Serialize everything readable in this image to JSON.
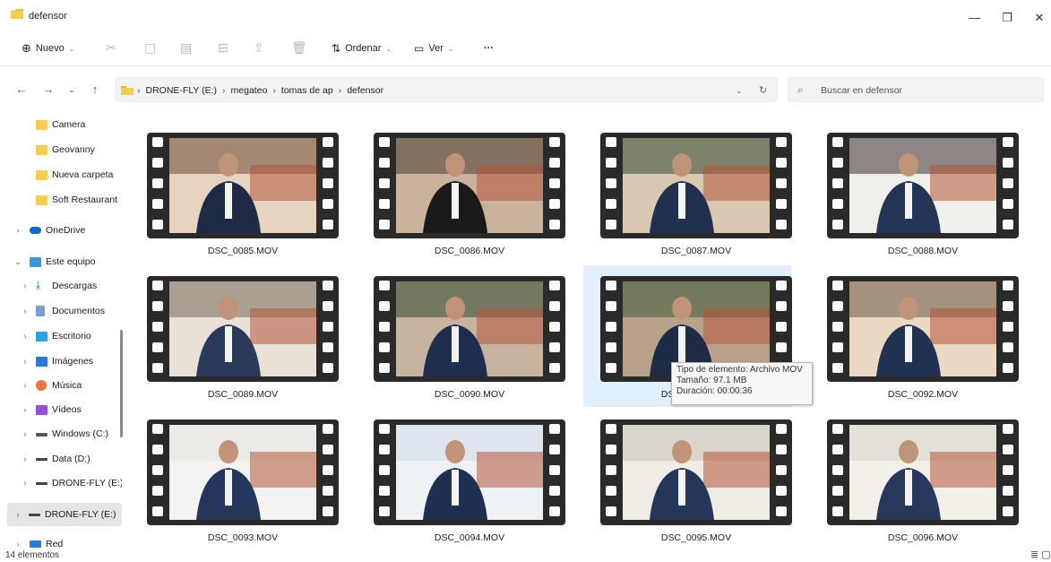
{
  "window": {
    "title": "defensor",
    "minimize": "—",
    "restore": "❐",
    "close": "✕"
  },
  "toolbar": {
    "new_label": "Nuevo",
    "sort_label": "Ordenar",
    "view_label": "Ver",
    "more_label": "···"
  },
  "address": {
    "crumbs": [
      "DRONE-FLY (E:)",
      "megateo",
      "tomas de ap",
      "defensor"
    ],
    "separator": "›"
  },
  "search": {
    "placeholder": "Buscar en defensor"
  },
  "sidebar": {
    "items": [
      {
        "label": "Camera",
        "icon": "folder-icon"
      },
      {
        "label": "Geovanny",
        "icon": "folder-icon"
      },
      {
        "label": "Nueva carpeta",
        "icon": "folder-icon"
      },
      {
        "label": "Soft Restaurant",
        "icon": "folder-icon"
      },
      {
        "label": "OneDrive",
        "icon": "cloud-icon"
      },
      {
        "label": "Este equipo",
        "icon": "computer-icon"
      },
      {
        "label": "Descargas",
        "icon": "download-icon"
      },
      {
        "label": "Documentos",
        "icon": "documents-icon"
      },
      {
        "label": "Escritorio",
        "icon": "desktop-icon"
      },
      {
        "label": "Imágenes",
        "icon": "pictures-icon"
      },
      {
        "label": "Música",
        "icon": "music-icon"
      },
      {
        "label": "Vídeos",
        "icon": "videos-icon"
      },
      {
        "label": "Windows (C:)",
        "icon": "drive-icon"
      },
      {
        "label": "Data (D:)",
        "icon": "drive-icon"
      },
      {
        "label": "DRONE-FLY (E:)",
        "icon": "drive-icon"
      },
      {
        "label": "DRONE-FLY (E:)",
        "icon": "drive-icon"
      },
      {
        "label": "Red",
        "icon": "network-icon"
      }
    ]
  },
  "files": [
    {
      "name": "DSC_0085.MOV"
    },
    {
      "name": "DSC_0086.MOV"
    },
    {
      "name": "DSC_0087.MOV"
    },
    {
      "name": "DSC_0088.MOV"
    },
    {
      "name": "DSC_0089.MOV"
    },
    {
      "name": "DSC_0090.MOV"
    },
    {
      "name": "DSC_0091.MOV"
    },
    {
      "name": "DSC_0092.MOV"
    },
    {
      "name": "DSC_0093.MOV"
    },
    {
      "name": "DSC_0094.MOV"
    },
    {
      "name": "DSC_0095.MOV"
    },
    {
      "name": "DSC_0096.MOV"
    }
  ],
  "tooltip": {
    "type_line": "Tipo de elemento: Archivo MOV",
    "size_line": "Tamaño: 97.1 MB",
    "duration_line": "Duración: 00:00:36"
  },
  "status": {
    "count": "14 elementos"
  },
  "colors": {
    "folder": "#f0c040",
    "accent": "#0067c0",
    "hover": "#e1eefb"
  }
}
